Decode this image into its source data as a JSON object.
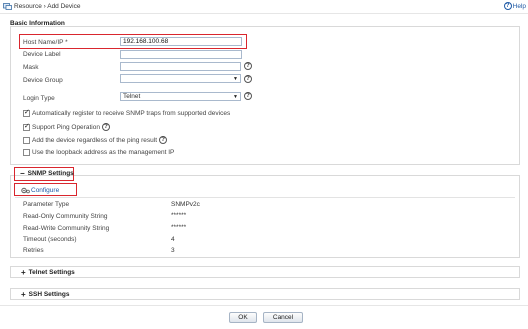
{
  "header": {
    "breadcrumb": "Resource › Add Device",
    "help": "Help"
  },
  "basic": {
    "title": "Basic Information",
    "host_label": "Host Name/IP *",
    "host_value": "192.168.100.68",
    "device_label_label": "Device Label",
    "device_label_value": "",
    "mask_label": "Mask",
    "mask_value": "",
    "group_label": "Device Group",
    "group_value": "",
    "login_label": "Login Type",
    "login_value": "Telnet",
    "checks": [
      {
        "label": "Automatically register to receive SNMP traps from supported devices",
        "checked": true
      },
      {
        "label": "Support Ping Operation",
        "checked": true
      },
      {
        "label": "Add the device regardless of the ping result",
        "checked": false
      },
      {
        "label": "Use the loopback address as the management IP",
        "checked": false
      }
    ]
  },
  "snmp": {
    "title": "SNMP Settings",
    "configure": "Configure",
    "rows": [
      {
        "label": "Parameter Type",
        "value": "SNMPv2c"
      },
      {
        "label": "Read-Only Community String",
        "value": "******"
      },
      {
        "label": "Read-Write Community String",
        "value": "******"
      },
      {
        "label": "Timeout (seconds)",
        "value": "4"
      },
      {
        "label": "Retries",
        "value": "3"
      }
    ]
  },
  "telnet": {
    "title": "Telnet Settings"
  },
  "ssh": {
    "title": "SSH Settings"
  },
  "buttons": {
    "ok": "OK",
    "cancel": "Cancel"
  },
  "colors": {
    "link": "#1f5aa6",
    "highlight": "#d9262e"
  },
  "icons": [
    "resource-icon",
    "help-icon",
    "question-icon",
    "configure-icon",
    "collapse-icon",
    "expand-icon"
  ]
}
